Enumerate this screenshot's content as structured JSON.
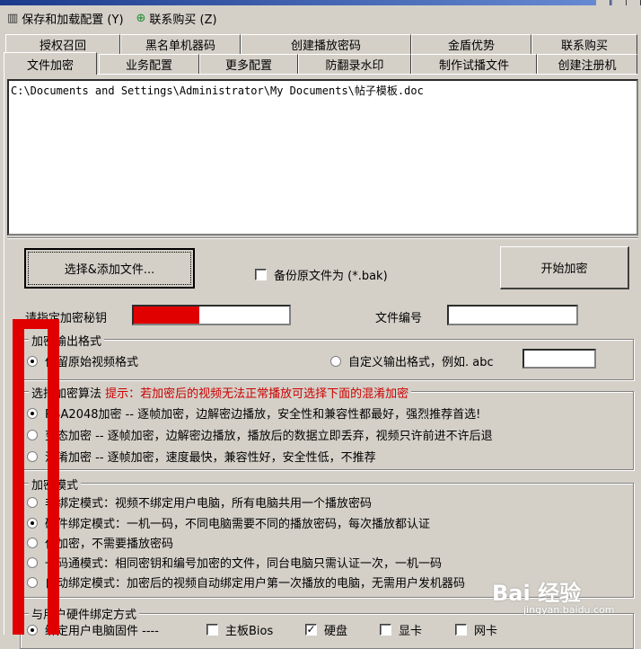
{
  "menu": {
    "save_config": "保存和加载配置 (Y)",
    "contact_buy": "联系购买 (Z)"
  },
  "tabs_row1": [
    "授权召回",
    "黑名单机器码",
    "创建播放密码",
    "金盾优势",
    "联系购买"
  ],
  "tabs_row2": [
    "文件加密",
    "业务配置",
    "更多配置",
    "防翻录水印",
    "制作试播文件",
    "创建注册机"
  ],
  "file_list": {
    "path": "C:\\Documents and Settings\\Administrator\\My Documents\\帖子模板.doc"
  },
  "actions": {
    "select_add": "选择&添加文件...",
    "backup_label": "备份原文件为 (*.bak)",
    "start_encrypt": "开始加密"
  },
  "key_section": {
    "key_label": "请指定加密秘钥",
    "file_no_label": "文件编号",
    "key_strength": 0.42
  },
  "output_format": {
    "title": "加密输出格式",
    "keep_original": "保留原始视频格式",
    "custom_format": "自定义输出格式，例如. abc"
  },
  "algorithm": {
    "title": "选择加密算法",
    "hint": "提示：若加密后的视频无法正常播放可选择下面的混淆加密",
    "options": [
      "RSA2048加密 --  逐帧加密，边解密边播放，安全性和兼容性都最好，强烈推荐首选!",
      "变态加密  -- 逐帧加密，边解密边播放，播放后的数据立即丢弃，视频只许前进不许后退",
      "混淆加密  -- 逐帧加密，速度最快，兼容性好，安全性低，不推荐"
    ]
  },
  "mode": {
    "title": "加密模式",
    "options": [
      "非绑定模式：视频不绑定用户电脑，所有电脑共用一个播放密码",
      "硬件绑定模式：一机一码，不同电脑需要不同的播放密码，每次播放都认证",
      "仅加密，不需要播放密码",
      "一码通模式：相同密钥和编号加密的文件，同台电脑只需认证一次，一机一码",
      "自动绑定模式：加密后的视频自动绑定用户第一次播放的电脑，无需用户发机器码"
    ]
  },
  "hardware": {
    "title": "与用户硬件绑定方式",
    "bind_label": "绑定用户电脑固件 ----",
    "items": [
      "主板Bios",
      "硬盘",
      "显卡",
      "网卡"
    ]
  },
  "watermark": {
    "logo_text": "Bai 经验",
    "url": "jingyan.baidu.com"
  }
}
